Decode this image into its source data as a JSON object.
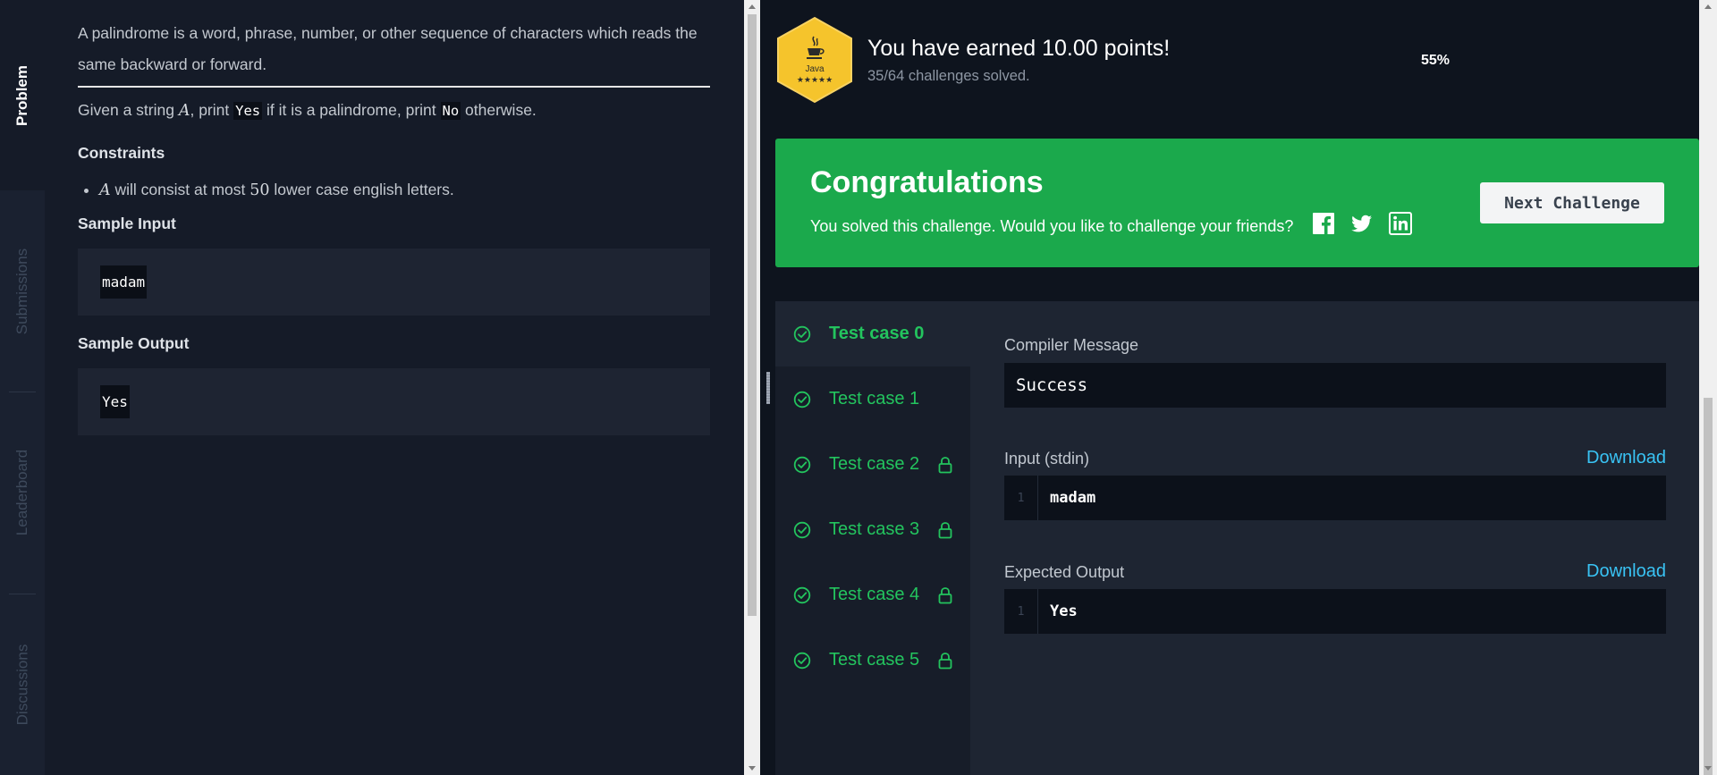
{
  "tabs": {
    "problem": "Problem",
    "submissions": "Submissions",
    "leaderboard": "Leaderboard",
    "discussions": "Discussions"
  },
  "problem": {
    "intro": "A palindrome is a word, phrase, number, or other sequence of characters which reads the same backward or forward.",
    "statement_pre": "Given a string ",
    "statement_var": "A",
    "statement_mid1": ", print ",
    "statement_yes": "Yes",
    "statement_mid2": " if it is a palindrome, print ",
    "statement_no": "No",
    "statement_post": " otherwise.",
    "constraints_title": "Constraints",
    "constraint_var": "A",
    "constraint_mid": " will consist at most ",
    "constraint_num": "50",
    "constraint_post": " lower case english letters.",
    "sample_input_title": "Sample Input",
    "sample_input": "madam",
    "sample_output_title": "Sample Output",
    "sample_output": "Yes"
  },
  "badge": {
    "language": "Java",
    "stars": "★★★★★",
    "icon": "java-cup-icon"
  },
  "points": {
    "title": "You have earned 10.00 points!",
    "subtitle": "35/64 challenges solved.",
    "progress_label": "55%",
    "progress": 0.55
  },
  "congrats": {
    "title": "Congratulations",
    "message": "You solved this challenge. Would you like to challenge your friends?",
    "next_button": "Next Challenge",
    "colors": {
      "banner": "#1ba94c"
    }
  },
  "test_cases": [
    {
      "label": "Test case 0",
      "locked": false,
      "active": true
    },
    {
      "label": "Test case 1",
      "locked": false,
      "active": false
    },
    {
      "label": "Test case 2",
      "locked": true,
      "active": false
    },
    {
      "label": "Test case 3",
      "locked": true,
      "active": false
    },
    {
      "label": "Test case 4",
      "locked": true,
      "active": false
    },
    {
      "label": "Test case 5",
      "locked": true,
      "active": false
    }
  ],
  "result": {
    "compiler_label": "Compiler Message",
    "compiler_message": "Success",
    "input_label": "Input (stdin)",
    "input_line_no": "1",
    "input_value": "madam",
    "output_label": "Expected Output",
    "output_line_no": "1",
    "output_value": "Yes",
    "download_label": "Download",
    "colors": {
      "pass": "#23c45e",
      "link": "#39c3f4"
    }
  }
}
